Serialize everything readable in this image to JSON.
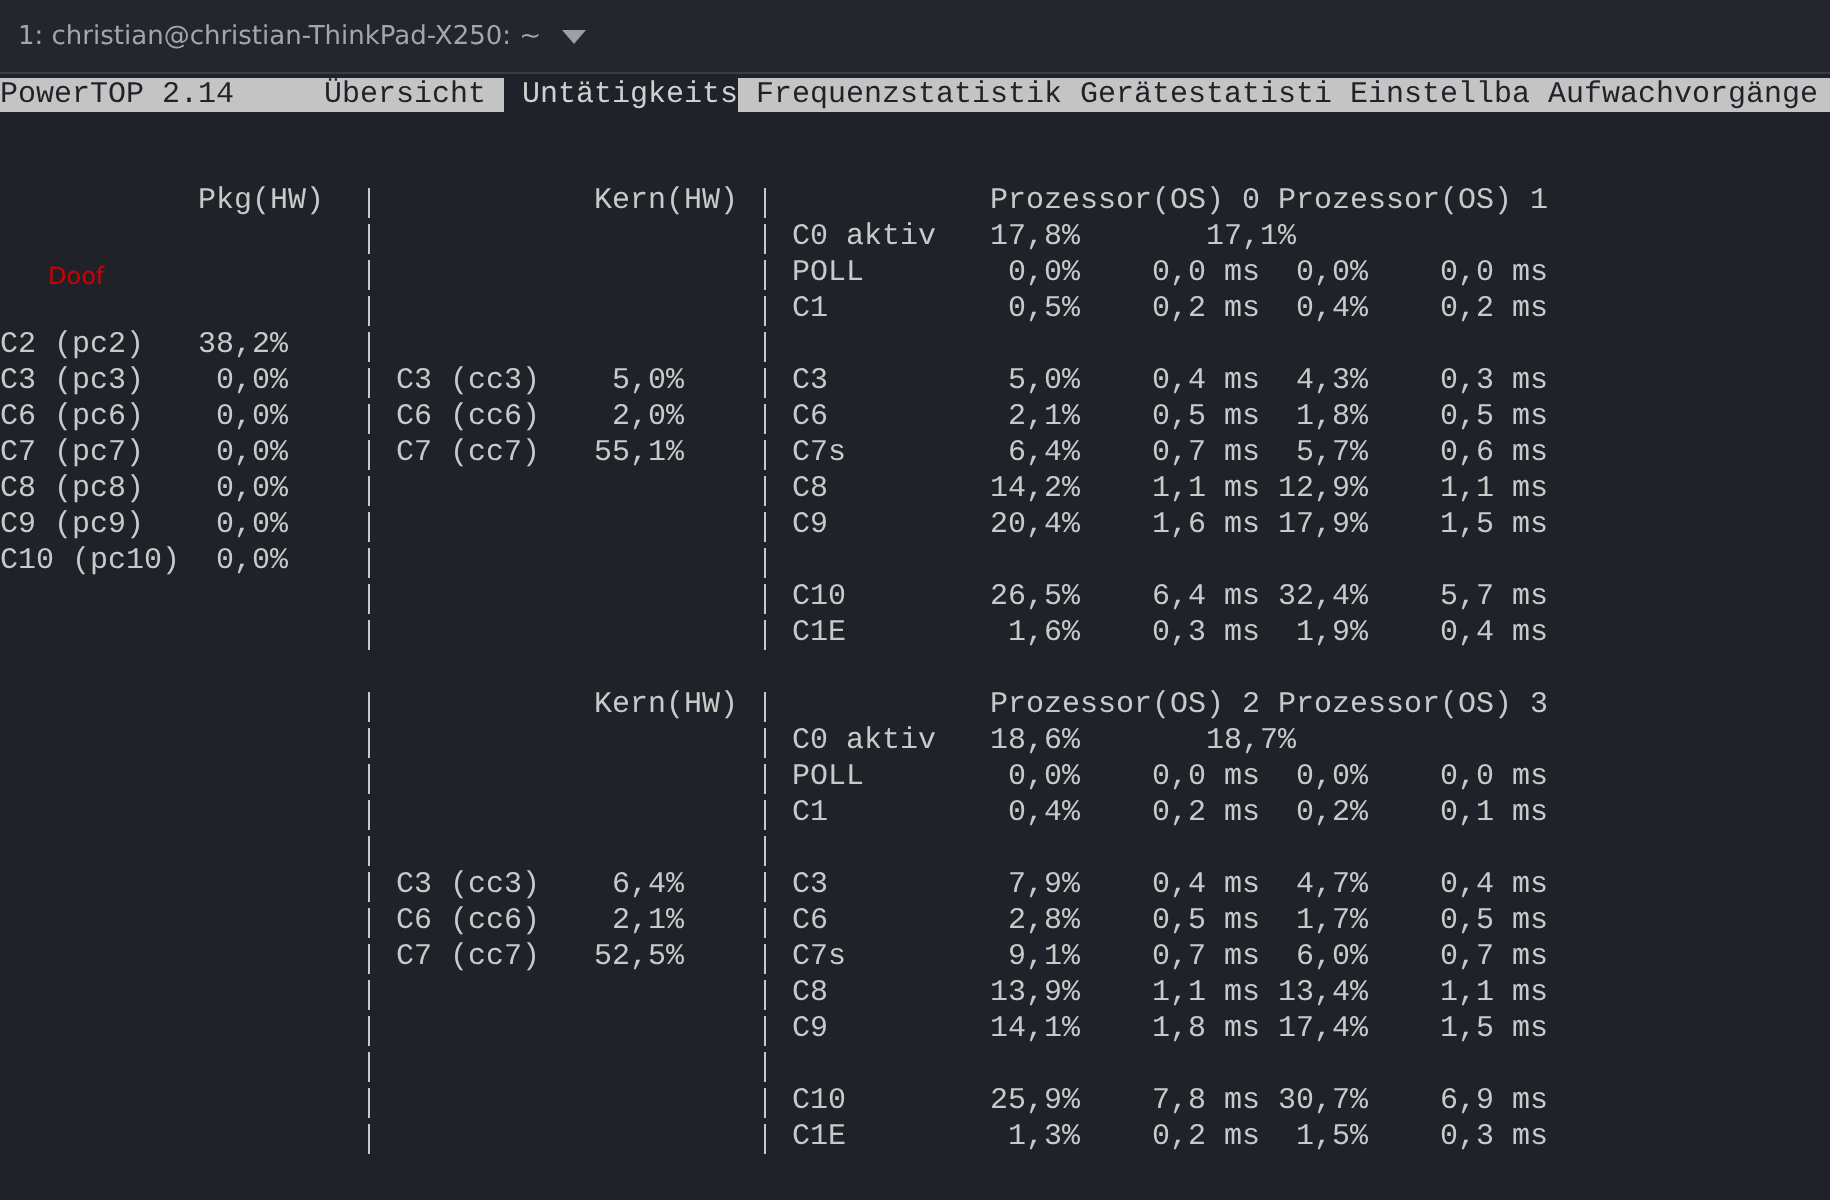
{
  "title_bar": {
    "title": "1: christian@christian-ThinkPad-X250: ~"
  },
  "menu_bar": {
    "app": "PowerTOP 2.14",
    "tabs": [
      {
        "label": "Übersicht",
        "selected": false
      },
      {
        "label": "Untätigkeits",
        "selected": true
      },
      {
        "label": "Frequenzstatistik",
        "selected": false
      },
      {
        "label": "Gerätestatisti",
        "selected": false
      },
      {
        "label": "Einstellba",
        "selected": false
      },
      {
        "label": "Aufwachvorgänge",
        "selected": false
      }
    ]
  },
  "overlay_text": "Doof",
  "blocks": [
    {
      "pkg_header": "Pkg(HW)",
      "core_header": "Kern(HW)",
      "cpu_headers": [
        "Prozessor(OS) 0",
        "Prozessor(OS) 1"
      ],
      "lines": [
        {
          "kind": "active",
          "state": "C0 aktiv",
          "cells": [
            "17,8%",
            "17,1%"
          ]
        },
        {
          "kind": "state",
          "state": "POLL",
          "cells": [
            "0,0%",
            "0,0 ms",
            "0,0%",
            "0,0 ms"
          ]
        },
        {
          "kind": "state",
          "state": "C1",
          "cells": [
            "0,5%",
            "0,2 ms",
            "0,4%",
            "0,2 ms"
          ]
        },
        {
          "kind": "blank",
          "pkg": [
            "C2 (pc2)",
            "38,2%"
          ]
        },
        {
          "kind": "state",
          "state": "C3",
          "cells": [
            "5,0%",
            "0,4 ms",
            "4,3%",
            "0,3 ms"
          ],
          "pkg": [
            "C3 (pc3)",
            "0,0%"
          ],
          "core": [
            "C3 (cc3)",
            "5,0%"
          ]
        },
        {
          "kind": "state",
          "state": "C6",
          "cells": [
            "2,1%",
            "0,5 ms",
            "1,8%",
            "0,5 ms"
          ],
          "pkg": [
            "C6 (pc6)",
            "0,0%"
          ],
          "core": [
            "C6 (cc6)",
            "2,0%"
          ]
        },
        {
          "kind": "state",
          "state": "C7s",
          "cells": [
            "6,4%",
            "0,7 ms",
            "5,7%",
            "0,6 ms"
          ],
          "pkg": [
            "C7 (pc7)",
            "0,0%"
          ],
          "core": [
            "C7 (cc7)",
            "55,1%"
          ]
        },
        {
          "kind": "state",
          "state": "C8",
          "cells": [
            "14,2%",
            "1,1 ms",
            "12,9%",
            "1,1 ms"
          ],
          "pkg": [
            "C8 (pc8)",
            "0,0%"
          ]
        },
        {
          "kind": "state",
          "state": "C9",
          "cells": [
            "20,4%",
            "1,6 ms",
            "17,9%",
            "1,5 ms"
          ],
          "pkg": [
            "C9 (pc9)",
            "0,0%"
          ]
        },
        {
          "kind": "blank",
          "pkg": [
            "C10 (pc10)",
            "0,0%"
          ]
        },
        {
          "kind": "state",
          "state": "C10",
          "cells": [
            "26,5%",
            "6,4 ms",
            "32,4%",
            "5,7 ms"
          ]
        },
        {
          "kind": "state",
          "state": "C1E",
          "cells": [
            "1,6%",
            "0,3 ms",
            "1,9%",
            "0,4 ms"
          ]
        }
      ]
    },
    {
      "core_header": "Kern(HW)",
      "cpu_headers": [
        "Prozessor(OS) 2",
        "Prozessor(OS) 3"
      ],
      "lines": [
        {
          "kind": "active",
          "state": "C0 aktiv",
          "cells": [
            "18,6%",
            "18,7%"
          ]
        },
        {
          "kind": "state",
          "state": "POLL",
          "cells": [
            "0,0%",
            "0,0 ms",
            "0,0%",
            "0,0 ms"
          ]
        },
        {
          "kind": "state",
          "state": "C1",
          "cells": [
            "0,4%",
            "0,2 ms",
            "0,2%",
            "0,1 ms"
          ]
        },
        {
          "kind": "blank"
        },
        {
          "kind": "state",
          "state": "C3",
          "cells": [
            "7,9%",
            "0,4 ms",
            "4,7%",
            "0,4 ms"
          ],
          "core": [
            "C3 (cc3)",
            "6,4%"
          ]
        },
        {
          "kind": "state",
          "state": "C6",
          "cells": [
            "2,8%",
            "0,5 ms",
            "1,7%",
            "0,5 ms"
          ],
          "core": [
            "C6 (cc6)",
            "2,1%"
          ]
        },
        {
          "kind": "state",
          "state": "C7s",
          "cells": [
            "9,1%",
            "0,7 ms",
            "6,0%",
            "0,7 ms"
          ],
          "core": [
            "C7 (cc7)",
            "52,5%"
          ]
        },
        {
          "kind": "state",
          "state": "C8",
          "cells": [
            "13,9%",
            "1,1 ms",
            "13,4%",
            "1,1 ms"
          ]
        },
        {
          "kind": "state",
          "state": "C9",
          "cells": [
            "14,1%",
            "1,8 ms",
            "17,4%",
            "1,5 ms"
          ]
        },
        {
          "kind": "blank"
        },
        {
          "kind": "state",
          "state": "C10",
          "cells": [
            "25,9%",
            "7,8 ms",
            "30,7%",
            "6,9 ms"
          ]
        },
        {
          "kind": "state",
          "state": "C1E",
          "cells": [
            "1,3%",
            "0,2 ms",
            "1,5%",
            "0,3 ms"
          ]
        }
      ]
    }
  ]
}
